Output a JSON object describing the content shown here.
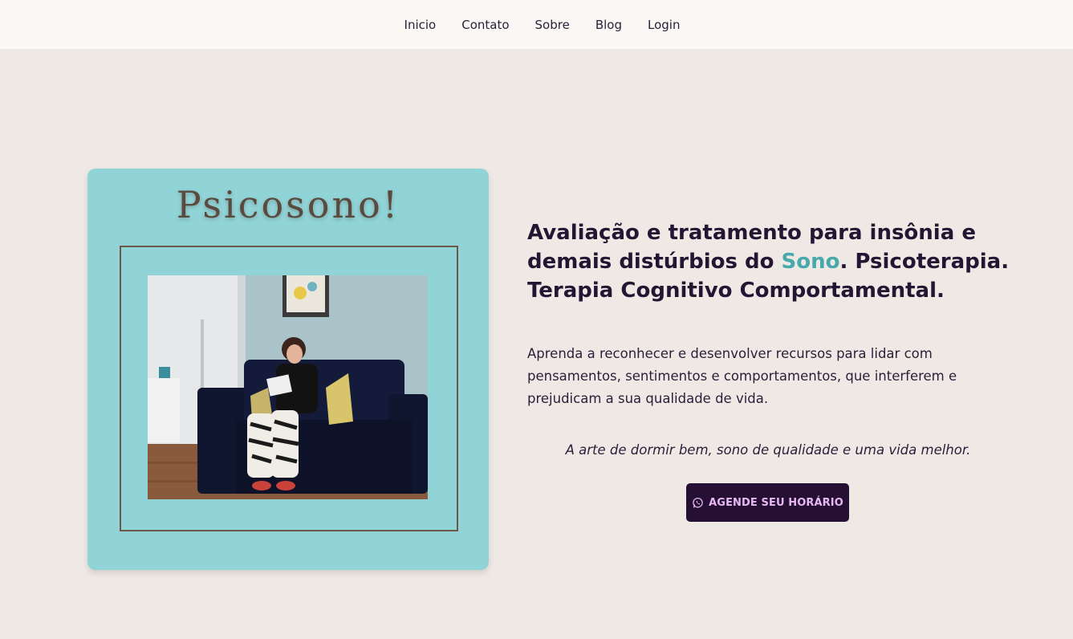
{
  "nav": {
    "items": [
      {
        "label": "Inicio"
      },
      {
        "label": "Contato"
      },
      {
        "label": "Sobre"
      },
      {
        "label": "Blog"
      },
      {
        "label": "Login"
      }
    ]
  },
  "hero_card": {
    "logo_text": "Psicosono!",
    "card_color": "#90d4d8",
    "frame_color": "#6b5846"
  },
  "main": {
    "headline_part1": "Avaliação e tratamento para insônia e demais distúrbios do ",
    "headline_accent": "Sono",
    "headline_part2": ". Psicoterapia. Terapia Cognitivo Comportamental.",
    "description": "Aprenda a reconhecer e desenvolver recursos para lidar com pensamentos, sentimentos e comportamentos, que interferem e prejudicam a sua qualidade de vida.",
    "tagline": "A arte de dormir bem, sono de qualidade e uma vida melhor.",
    "cta": {
      "label": "AGENDE SEU HORÁRIO",
      "icon": "whatsapp-icon"
    }
  },
  "colors": {
    "background": "#efe9e6",
    "navbar": "#faf7f4",
    "text": "#241533",
    "accent": "#47a9ac",
    "button_bg": "#251033",
    "button_text": "#e8b8f5"
  }
}
